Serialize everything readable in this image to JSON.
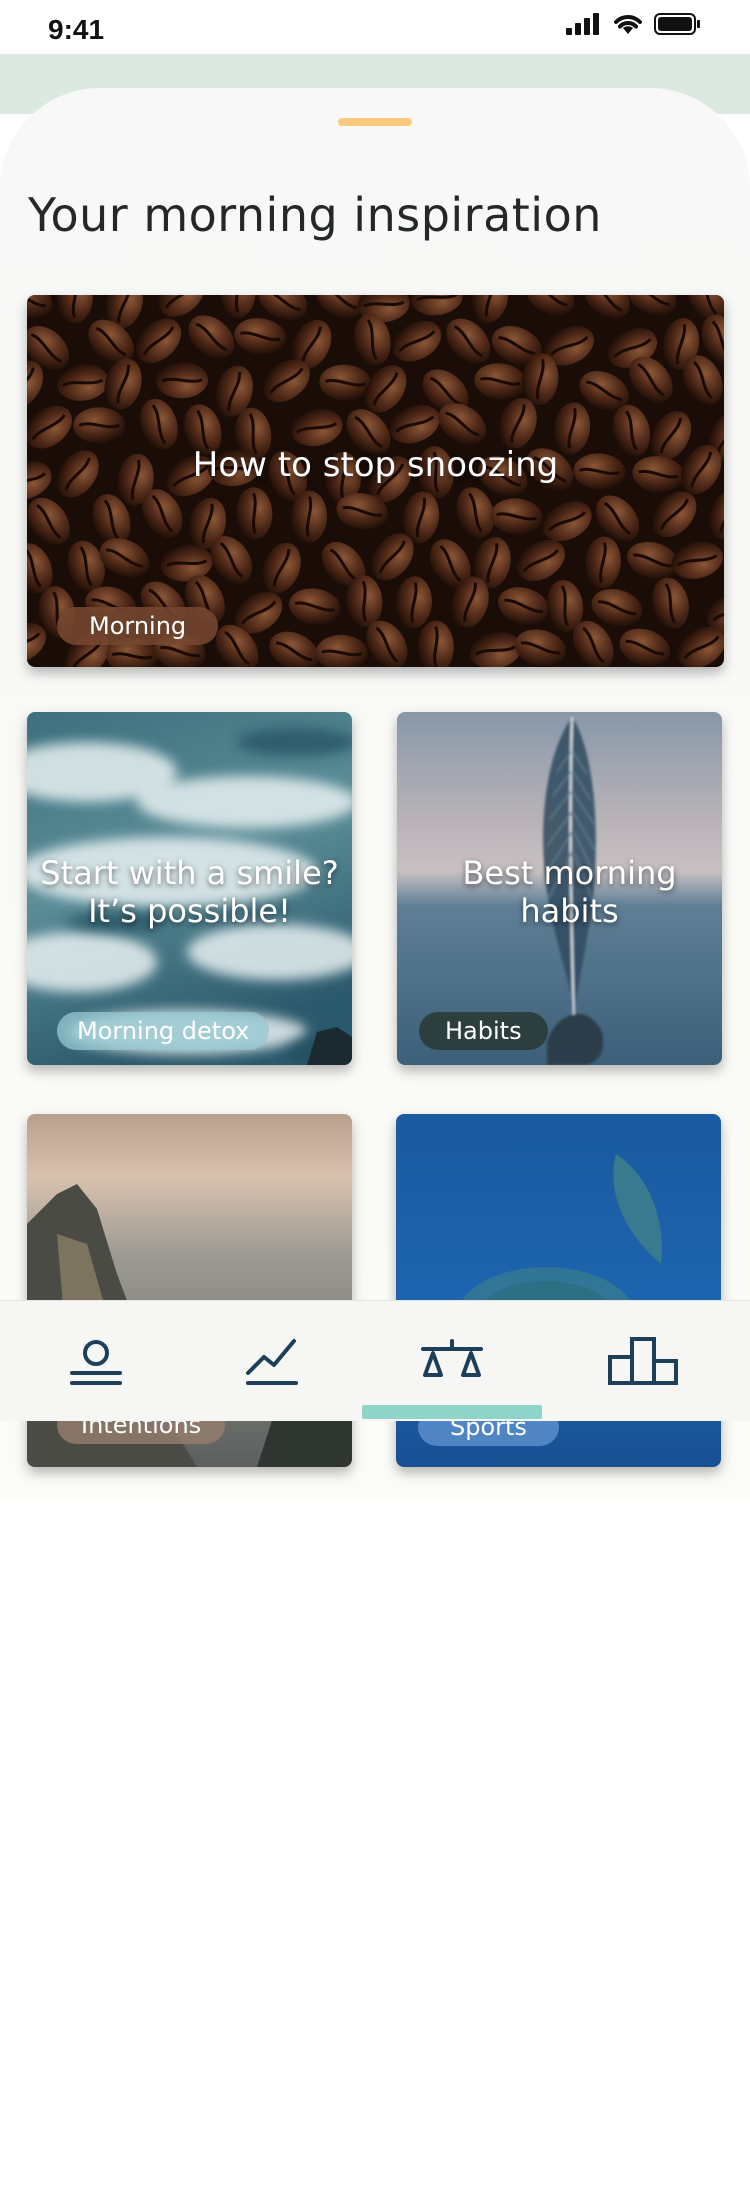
{
  "status_bar": {
    "time": "9:41"
  },
  "sheet": {
    "title": "Your morning inspiration"
  },
  "cards": [
    {
      "title": "How to stop snoozing",
      "tag": "Morning",
      "image": "coffee-beans"
    },
    {
      "title": "Start with a smile? It’s possible!",
      "tag": "Morning detox",
      "image": "ocean-waves"
    },
    {
      "title": "Best morning habits",
      "tag": "Habits",
      "image": "feather"
    },
    {
      "title": "",
      "tag": "Intentions",
      "image": "cliff-sunset"
    },
    {
      "title": "",
      "tag": "Sports",
      "image": "sea-turtle"
    }
  ],
  "bottom_nav": {
    "items": [
      "profile-icon",
      "chart-icon",
      "balance-icon",
      "podium-icon"
    ],
    "active_index": 2
  },
  "colors": {
    "accent": "#8fd4c9",
    "grabber": "#f9c97d",
    "icon": "#1d3f5a",
    "top_band": "#dce9e1"
  }
}
